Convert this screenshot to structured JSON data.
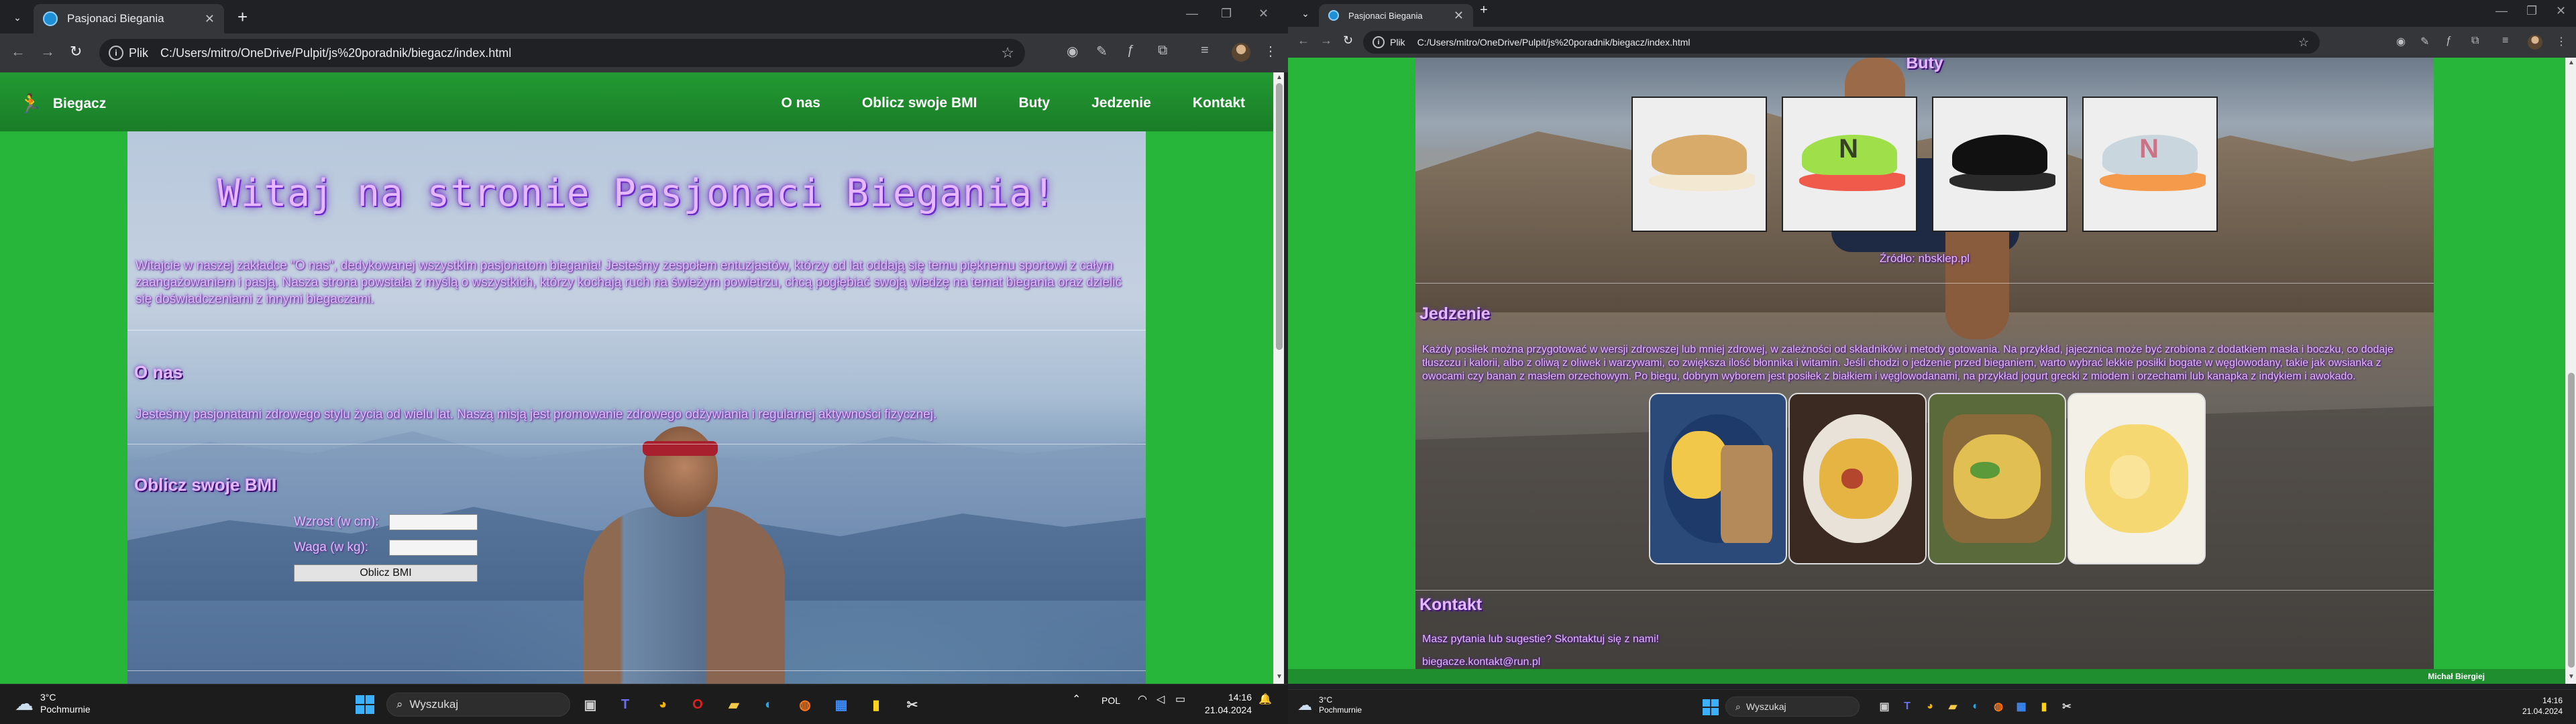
{
  "browser": {
    "tab_title": "Pasjonaci Biegania",
    "plik_label": "Plik",
    "url": "C:/Users/mitro/OneDrive/Pulpit/js%20poradnik/biegacz/index.html"
  },
  "site": {
    "brand": "Biegacz",
    "nav": [
      "O nas",
      "Oblicz swoje BMI",
      "Buty",
      "Jedzenie",
      "Kontakt"
    ],
    "hero_title": "Witaj na stronie Pasjonaci Biegania!",
    "intro": "Witajcie w naszej zakładce \"O nas\", dedykowanej wszystkim pasjonatom biegania! Jesteśmy zespołem entuzjastów, którzy od lat oddają się temu pięknemu sportowi z całym zaangażowaniem i pasją. Nasza strona powstała z myślą o wszystkich, którzy kochają ruch na świeżym powietrzu, chcą pogłębiać swoją wiedzę na temat biegania oraz dzielić się doświadczeniami z innymi biegaczami.",
    "about_heading": "O nas",
    "about_text": "Jesteśmy pasjonatami zdrowego stylu życia od wielu lat. Naszą misją jest promowanie zdrowego odżywiania i regularnej aktywności fizycznej.",
    "bmi_heading": "Oblicz swoje BMI",
    "bmi_height_label": "Wzrost (w cm):",
    "bmi_weight_label": "Waga (w kg):",
    "bmi_button": "Oblicz BMI",
    "shoes_heading": "Buty",
    "shoes_source": "Źródło: nbsklep.pl",
    "food_heading": "Jedzenie",
    "food_text": "Każdy posiłek można przygotować w wersji zdrowszej lub mniej zdrowej, w zależności od składników i metody gotowania. Na przykład, jajecznica może być zrobiona z dodatkiem masła i boczku, co dodaje tłuszczu i kalorii, albo z oliwą z oliwek i warzywami, co zwiększa ilość błonnika i witamin. Jeśli chodzi o jedzenie przed bieganiem, warto wybrać lekkie posiłki bogate w węglowodany, takie jak owsianka z owocami czy banan z masłem orzechowym. Po biegu, dobrym wyborem jest posiłek z białkiem i węglowodanami, na przykład jogurt grecki z miodem i orzechami lub kanapka z indykiem i awokado.",
    "contact_heading": "Kontakt",
    "contact_text": "Masz pytania lub sugestie? Skontaktuj się z nami!",
    "contact_email": "biegacze.kontakt@run.pl",
    "footer": "Michał Biergiej"
  },
  "taskbar_left": {
    "temp": "3°C",
    "cond": "Pochmurnie",
    "search": "Wyszukaj",
    "lang": "POL",
    "time": "14:16",
    "date": "21.04.2024"
  },
  "taskbar_right": {
    "temp": "3°C",
    "cond": "Pochmurnie",
    "search": "Wyszukaj",
    "time": "14:16",
    "date": "21.04.2024"
  },
  "colors": {
    "site_green": "#27b53a",
    "heading_purple": "#e6b8ff"
  }
}
